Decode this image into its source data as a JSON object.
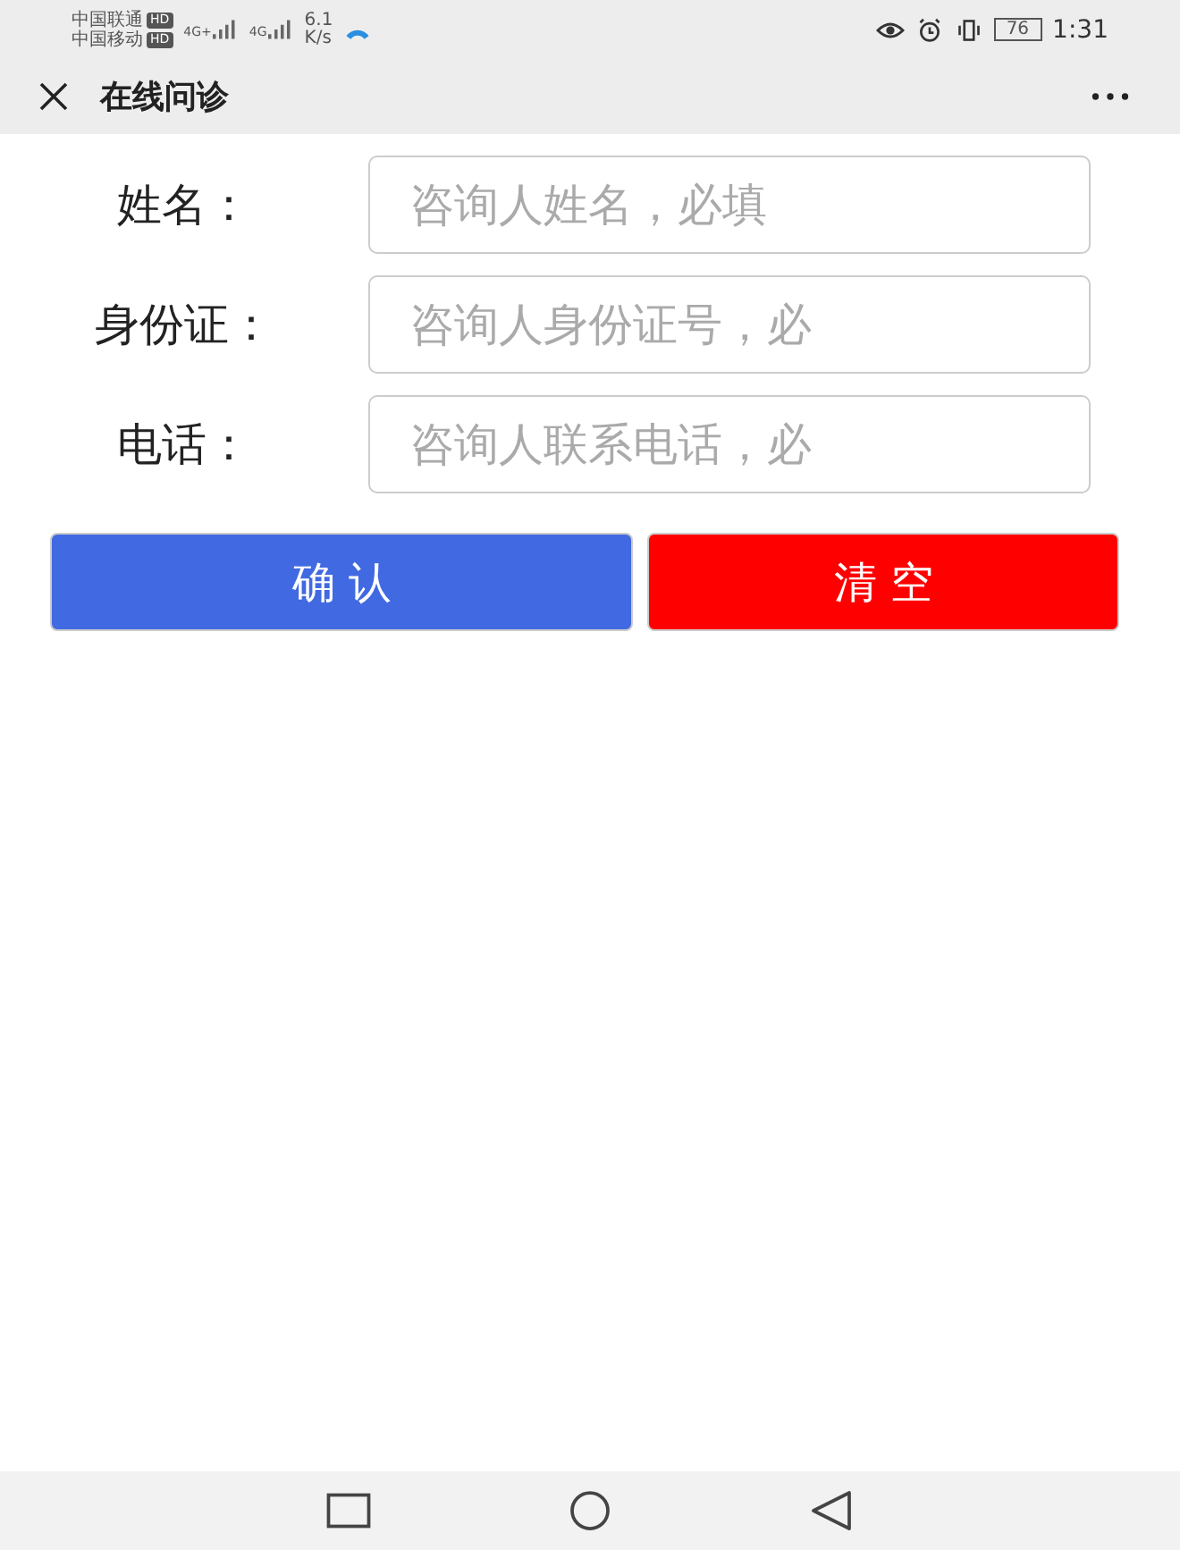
{
  "status_bar": {
    "carriers": [
      "中国联通",
      "中国移动"
    ],
    "hd_badges": [
      "HD",
      "HD"
    ],
    "networks": [
      "4G+",
      "4G"
    ],
    "speed": "6.1",
    "speed_unit": "K/s",
    "battery": "76",
    "time": "1:31"
  },
  "title_bar": {
    "title": "在线问诊"
  },
  "form": {
    "fields": [
      {
        "label": "姓名：",
        "placeholder": "咨询人姓名，必填"
      },
      {
        "label": "身份证：",
        "placeholder": "咨询人身份证号，必"
      },
      {
        "label": "电话：",
        "placeholder": "咨询人联系电话，必"
      }
    ]
  },
  "buttons": [
    {
      "label": "确 认",
      "kind": "primary"
    },
    {
      "label": "清 空",
      "kind": "danger"
    }
  ]
}
